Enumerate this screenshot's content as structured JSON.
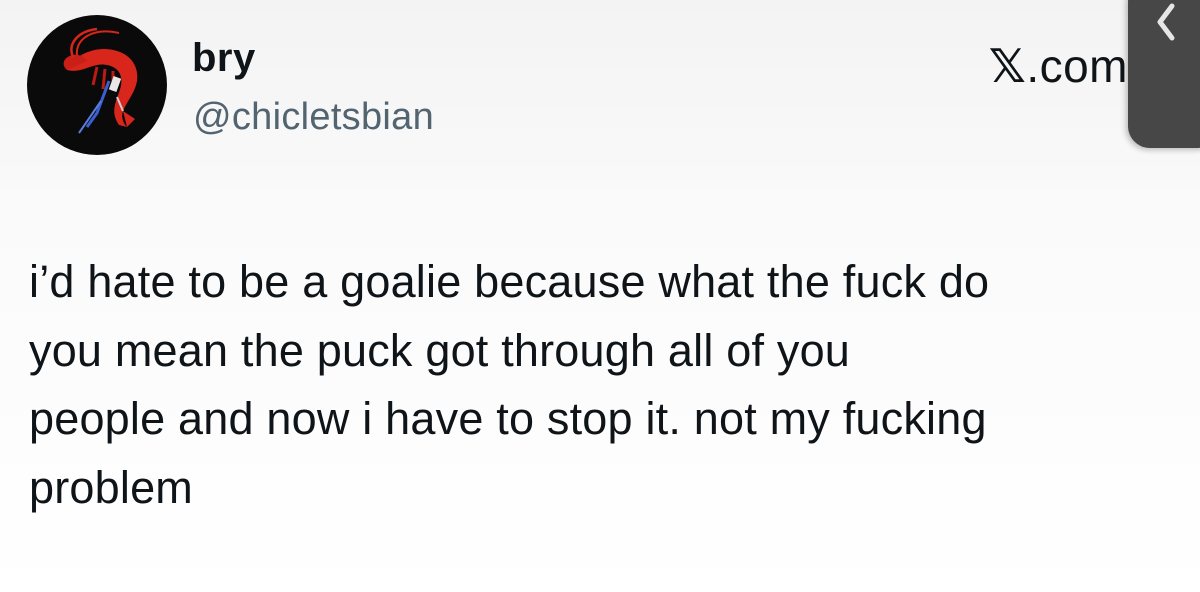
{
  "tweet": {
    "author": {
      "display_name": "bry",
      "handle": "@chicletsbian",
      "avatar_icon": "red-shrimp-avatar-icon"
    },
    "watermark": {
      "x_glyph": "𝕏",
      "suffix": ".com"
    },
    "text_lines": [
      "i’d hate to be a goalie because what the fuck do",
      "you mean the puck got through all of you",
      "people and now i have to stop it. not my fucking",
      "problem"
    ]
  },
  "side_tab": {
    "icon": "chevron-left-icon"
  },
  "colors": {
    "text_primary": "#0f1419",
    "text_secondary": "#536471",
    "avatar_bg": "#0a0a0a",
    "shrimp_red": "#d8261c",
    "side_tab_bg": "#474747"
  }
}
